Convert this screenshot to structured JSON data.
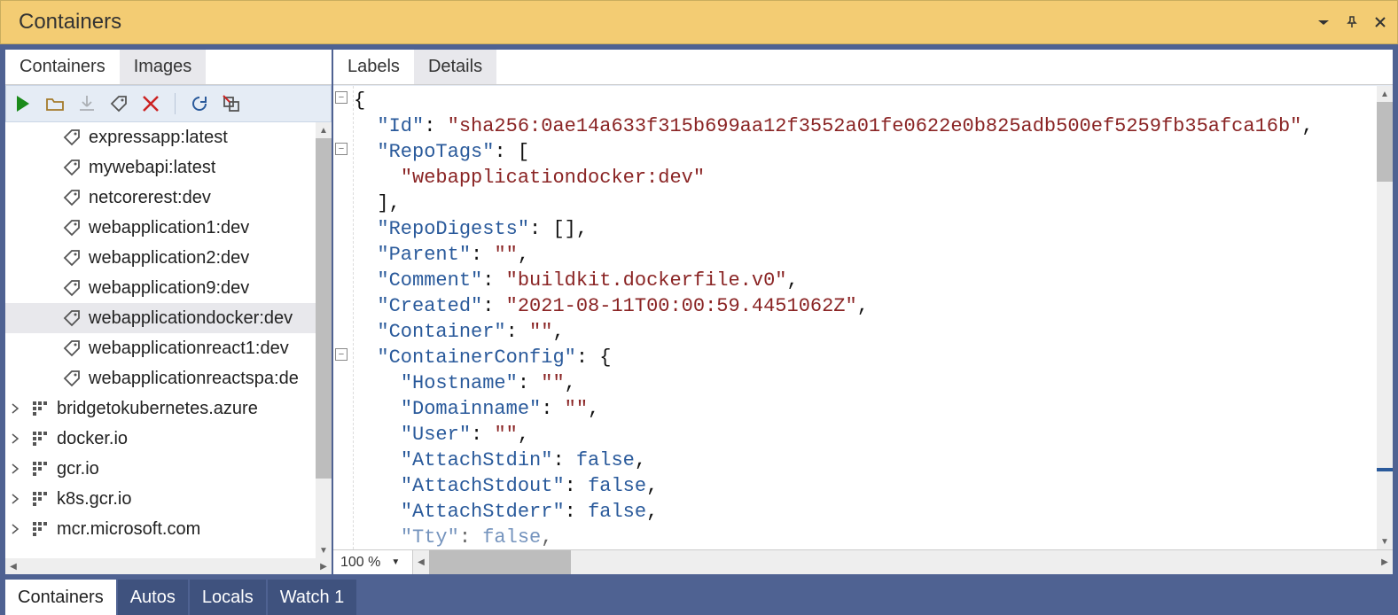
{
  "window": {
    "title": "Containers"
  },
  "leftTabs": {
    "containers": "Containers",
    "images": "Images",
    "active": "images"
  },
  "rightTabs": {
    "labels": "Labels",
    "details": "Details",
    "active": "details"
  },
  "toolbar_icons": [
    "run",
    "open",
    "download",
    "tag",
    "delete",
    "refresh",
    "prune"
  ],
  "tree": {
    "items": [
      {
        "type": "tag",
        "label": "expressapp:latest"
      },
      {
        "type": "tag",
        "label": "mywebapi:latest"
      },
      {
        "type": "tag",
        "label": "netcorerest:dev"
      },
      {
        "type": "tag",
        "label": "webapplication1:dev"
      },
      {
        "type": "tag",
        "label": "webapplication2:dev"
      },
      {
        "type": "tag",
        "label": "webapplication9:dev"
      },
      {
        "type": "tag",
        "label": "webapplicationdocker:dev",
        "selected": true
      },
      {
        "type": "tag",
        "label": "webapplicationreact1:dev"
      },
      {
        "type": "tag",
        "label": "webapplicationreactspa:de"
      },
      {
        "type": "registry",
        "label": "bridgetokubernetes.azure",
        "expandable": true
      },
      {
        "type": "registry",
        "label": "docker.io",
        "expandable": true
      },
      {
        "type": "registry",
        "label": "gcr.io",
        "expandable": true
      },
      {
        "type": "registry",
        "label": "k8s.gcr.io",
        "expandable": true
      },
      {
        "type": "registry",
        "label": "mcr.microsoft.com",
        "expandable": true
      }
    ]
  },
  "zoom": "100 %",
  "json_lines": [
    {
      "indent": 0,
      "tokens": [
        {
          "t": "punc",
          "v": "{"
        }
      ],
      "fold": "minus"
    },
    {
      "indent": 1,
      "tokens": [
        {
          "t": "prop",
          "v": "\"Id\""
        },
        {
          "t": "punc",
          "v": ": "
        },
        {
          "t": "s",
          "v": "\"sha256:0ae14a633f315b699aa12f3552a01fe0622e0b825adb500ef5259fb35afca16b\""
        },
        {
          "t": "punc",
          "v": ","
        }
      ]
    },
    {
      "indent": 1,
      "tokens": [
        {
          "t": "prop",
          "v": "\"RepoTags\""
        },
        {
          "t": "punc",
          "v": ": ["
        }
      ],
      "fold": "minus"
    },
    {
      "indent": 2,
      "tokens": [
        {
          "t": "s",
          "v": "\"webapplicationdocker:dev\""
        }
      ]
    },
    {
      "indent": 1,
      "tokens": [
        {
          "t": "punc",
          "v": "],"
        }
      ]
    },
    {
      "indent": 1,
      "tokens": [
        {
          "t": "prop",
          "v": "\"RepoDigests\""
        },
        {
          "t": "punc",
          "v": ": [],"
        }
      ]
    },
    {
      "indent": 1,
      "tokens": [
        {
          "t": "prop",
          "v": "\"Parent\""
        },
        {
          "t": "punc",
          "v": ": "
        },
        {
          "t": "s",
          "v": "\"\""
        },
        {
          "t": "punc",
          "v": ","
        }
      ]
    },
    {
      "indent": 1,
      "tokens": [
        {
          "t": "prop",
          "v": "\"Comment\""
        },
        {
          "t": "punc",
          "v": ": "
        },
        {
          "t": "s",
          "v": "\"buildkit.dockerfile.v0\""
        },
        {
          "t": "punc",
          "v": ","
        }
      ]
    },
    {
      "indent": 1,
      "tokens": [
        {
          "t": "prop",
          "v": "\"Created\""
        },
        {
          "t": "punc",
          "v": ": "
        },
        {
          "t": "s",
          "v": "\"2021-08-11T00:00:59.4451062Z\""
        },
        {
          "t": "punc",
          "v": ","
        }
      ]
    },
    {
      "indent": 1,
      "tokens": [
        {
          "t": "prop",
          "v": "\"Container\""
        },
        {
          "t": "punc",
          "v": ": "
        },
        {
          "t": "s",
          "v": "\"\""
        },
        {
          "t": "punc",
          "v": ","
        }
      ]
    },
    {
      "indent": 1,
      "tokens": [
        {
          "t": "prop",
          "v": "\"ContainerConfig\""
        },
        {
          "t": "punc",
          "v": ": {"
        }
      ],
      "fold": "minus"
    },
    {
      "indent": 2,
      "tokens": [
        {
          "t": "prop",
          "v": "\"Hostname\""
        },
        {
          "t": "punc",
          "v": ": "
        },
        {
          "t": "s",
          "v": "\"\""
        },
        {
          "t": "punc",
          "v": ","
        }
      ]
    },
    {
      "indent": 2,
      "tokens": [
        {
          "t": "prop",
          "v": "\"Domainname\""
        },
        {
          "t": "punc",
          "v": ": "
        },
        {
          "t": "s",
          "v": "\"\""
        },
        {
          "t": "punc",
          "v": ","
        }
      ]
    },
    {
      "indent": 2,
      "tokens": [
        {
          "t": "prop",
          "v": "\"User\""
        },
        {
          "t": "punc",
          "v": ": "
        },
        {
          "t": "s",
          "v": "\"\""
        },
        {
          "t": "punc",
          "v": ","
        }
      ]
    },
    {
      "indent": 2,
      "tokens": [
        {
          "t": "prop",
          "v": "\"AttachStdin\""
        },
        {
          "t": "punc",
          "v": ": "
        },
        {
          "t": "bool",
          "v": "false"
        },
        {
          "t": "punc",
          "v": ","
        }
      ]
    },
    {
      "indent": 2,
      "tokens": [
        {
          "t": "prop",
          "v": "\"AttachStdout\""
        },
        {
          "t": "punc",
          "v": ": "
        },
        {
          "t": "bool",
          "v": "false"
        },
        {
          "t": "punc",
          "v": ","
        }
      ]
    },
    {
      "indent": 2,
      "tokens": [
        {
          "t": "prop",
          "v": "\"AttachStderr\""
        },
        {
          "t": "punc",
          "v": ": "
        },
        {
          "t": "bool",
          "v": "false"
        },
        {
          "t": "punc",
          "v": ","
        }
      ]
    },
    {
      "indent": 2,
      "tokens": [
        {
          "t": "prop",
          "v": "\"Tty\""
        },
        {
          "t": "punc",
          "v": ": "
        },
        {
          "t": "bool",
          "v": "false"
        },
        {
          "t": "punc",
          "v": ","
        }
      ],
      "cut": true
    }
  ],
  "bottomTabs": {
    "items": [
      "Containers",
      "Autos",
      "Locals",
      "Watch 1"
    ],
    "active": 0
  }
}
